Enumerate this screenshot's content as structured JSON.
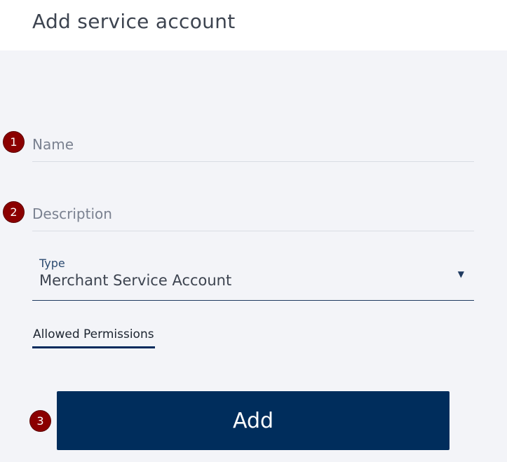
{
  "header": {
    "title": "Add service account"
  },
  "form": {
    "name": {
      "placeholder": "Name",
      "value": ""
    },
    "description": {
      "placeholder": "Description",
      "value": ""
    },
    "type": {
      "label": "Type",
      "selected": "Merchant Service Account",
      "caret": "▼"
    },
    "permissions_tab": {
      "label": "Allowed Permissions"
    },
    "add_button": {
      "label": "Add"
    }
  },
  "annotations": [
    "1",
    "2",
    "3"
  ],
  "colors": {
    "primary": "#002d5c",
    "background": "#f3f4f8",
    "header_background": "#ffffff",
    "annotation_badge": "#8b0000"
  }
}
